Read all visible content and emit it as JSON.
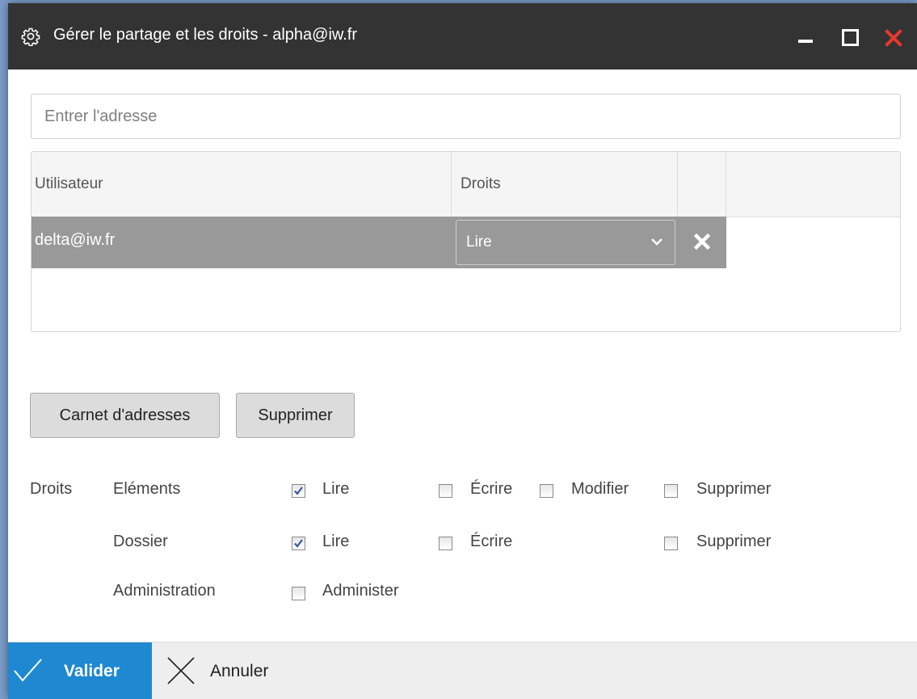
{
  "window": {
    "title": "Gérer le partage et les droits - alpha@iw.fr",
    "controls": [
      "minimize-icon",
      "maximize-icon",
      "close-icon"
    ],
    "close_color": "#e8392b"
  },
  "address": {
    "placeholder": "Entrer l'adresse",
    "value": ""
  },
  "grid": {
    "columns": [
      "Utilisateur",
      "Droits",
      "",
      ""
    ],
    "rows": [
      {
        "user": "delta@iw.fr",
        "rights": "Lire",
        "selected": true
      }
    ]
  },
  "buttons": {
    "address_book": "Carnet d'adresses",
    "delete": "Supprimer"
  },
  "permissions": {
    "label": "Droits",
    "elements": {
      "label": "Eléments",
      "read": {
        "label": "Lire",
        "checked": true
      },
      "write": {
        "label": "Écrire",
        "checked": false
      },
      "modify": {
        "label": "Modifier",
        "checked": false
      },
      "delete": {
        "label": "Supprimer",
        "checked": false
      }
    },
    "folder": {
      "label": "Dossier",
      "read": {
        "label": "Lire",
        "checked": true
      },
      "write": {
        "label": "Écrire",
        "checked": false
      },
      "delete": {
        "label": "Supprimer",
        "checked": false
      }
    },
    "administration": {
      "label": "Administration",
      "administer": {
        "label": "Administer",
        "checked": false
      }
    }
  },
  "footer": {
    "ok": "Valider",
    "cancel": "Annuler",
    "accent": "#1e88d0"
  }
}
